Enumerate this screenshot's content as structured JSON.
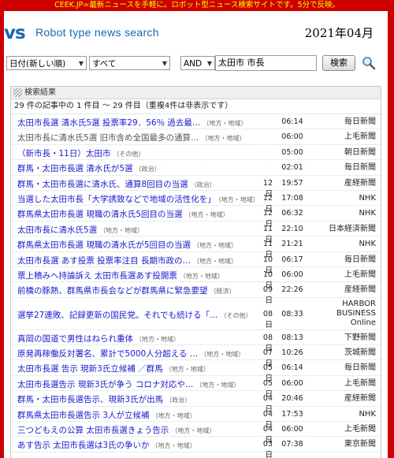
{
  "banner": "CEEK.JP=最新ニュースを手軽に。ロボット型ニュース検索サイトです。5分で反映。",
  "header": {
    "logo_fragment": "vs",
    "tagline": "Robot type news search",
    "date": "2021年04月"
  },
  "search": {
    "sort": "日付(新しい順)",
    "category": "すべて",
    "operator": "AND",
    "query": "太田市 市長",
    "button": "検索"
  },
  "results": {
    "heading": "検索結果",
    "summary": "29 件の記事中の 1 件目 ～ 29 件目（重複4件は非表示です）",
    "rows": [
      {
        "title": "太田市長選 清水氏5選 投票率29．56％ 過去最…",
        "cat": "（地方・地域）",
        "day": "",
        "time": "06:14",
        "source": "毎日新聞"
      },
      {
        "title": "太田市長に清水氏5選 旧市含め全国最多の通算…",
        "cat": "（地方・地域）",
        "day": "",
        "time": "06:00",
        "source": "上毛新聞",
        "visited": true
      },
      {
        "title": "（新市長・11日）太田市",
        "cat": "（その他）",
        "day": "",
        "time": "05:00",
        "source": "朝日新聞"
      },
      {
        "title": "群馬・太田市長選 清水氏が5選",
        "cat": "（政治）",
        "day": "",
        "time": "02:01",
        "source": "毎日新聞"
      },
      {
        "title": "群馬・太田市長選に清水氏、通算8回目の当選",
        "cat": "（政治）",
        "day": "12日",
        "time": "19:57",
        "source": "産経新聞"
      },
      {
        "title": "当選した太田市長「大学誘致などで地域の活性化を」",
        "cat": "（地方・地域）",
        "day": "12日",
        "time": "17:08",
        "source": "NHK"
      },
      {
        "title": "群馬県太田市長選 現職の清水氏5回目の当選",
        "cat": "（地方・地域）",
        "day": "12日",
        "time": "06:32",
        "source": "NHK"
      },
      {
        "title": "太田市長に清水氏5選",
        "cat": "（地方・地域）",
        "day": "11日",
        "time": "22:10",
        "source": "日本経済新聞"
      },
      {
        "title": "群馬県太田市長選 現職の清水氏が5回目の当選",
        "cat": "（地方・地域）",
        "day": "11日",
        "time": "21:21",
        "source": "NHK"
      },
      {
        "title": "太田市長選 あす投票 投票率注目 長期市政の…",
        "cat": "（地方・地域）",
        "day": "10日",
        "time": "06:17",
        "source": "毎日新聞"
      },
      {
        "title": "票上積みへ持論訴え 太田市長選あす投開票",
        "cat": "（地方・地域）",
        "day": "10日",
        "time": "06:00",
        "source": "上毛新聞"
      },
      {
        "title": "前橋の豚熱、群馬県市長会などが群馬県に緊急要望",
        "cat": "（経済）",
        "day": "09日",
        "time": "22:26",
        "source": "産経新聞"
      },
      {
        "title": "選挙27連敗、記録更新の国民党。それでも続ける「…",
        "cat": "（その他）",
        "day": "08日",
        "time": "08:33",
        "source": "HARBOR\nBUSINESS\nOnline",
        "tall": true
      },
      {
        "title": "真岡の国道で男性はねられ重体",
        "cat": "（地方・地域）",
        "day": "08日",
        "time": "08:13",
        "source": "下野新聞"
      },
      {
        "title": "原発再稼働反対署名、累計で5000人分超える …",
        "cat": "（地方・地域）",
        "day": "07日",
        "time": "10:26",
        "source": "茨城新聞"
      },
      {
        "title": "太田市長選 告示 現新3氏立候補 ／群馬",
        "cat": "（地方・地域）",
        "day": "05日",
        "time": "06:14",
        "source": "毎日新聞"
      },
      {
        "title": "太田市長選告示 現新3氏が争う コロナ対応や…",
        "cat": "（地方・地域）",
        "day": "05日",
        "time": "06:00",
        "source": "上毛新聞"
      },
      {
        "title": "群馬・太田市長選告示、現新3氏が出馬",
        "cat": "（政治）",
        "day": "04日",
        "time": "20:46",
        "source": "産経新聞"
      },
      {
        "title": "群馬県太田市長選告示 3人が立候補",
        "cat": "（地方・地域）",
        "day": "04日",
        "time": "17:53",
        "source": "NHK"
      },
      {
        "title": "三つどもえの公算 太田市長選きょう告示",
        "cat": "（地方・地域）",
        "day": "04日",
        "time": "06:00",
        "source": "上毛新聞"
      },
      {
        "title": "あす告示 太田市長選は3氏の争いか",
        "cat": "（地方・地域）",
        "day": "03日",
        "time": "07:38",
        "source": "東京新聞"
      }
    ]
  }
}
